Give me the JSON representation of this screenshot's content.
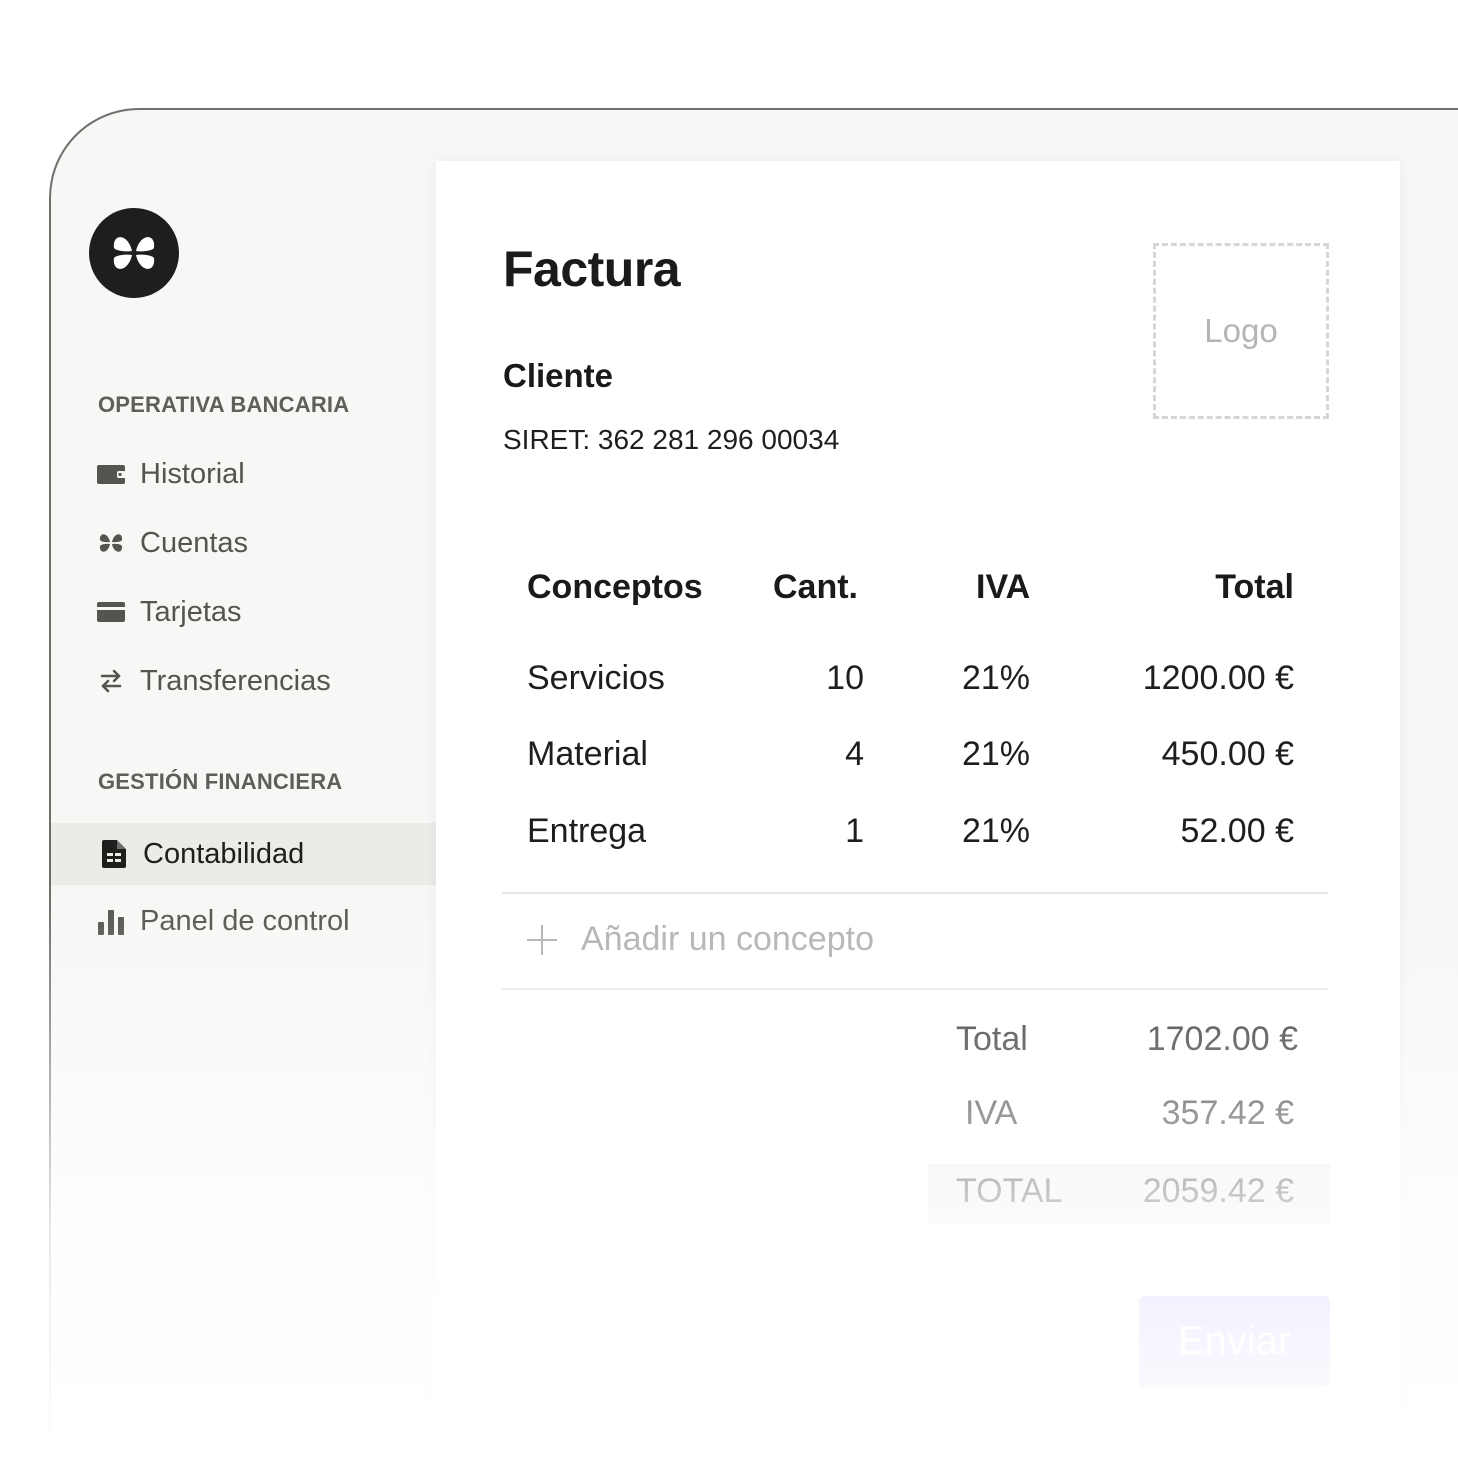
{
  "sidebar": {
    "sections": [
      {
        "title": "OPERATIVA BANCARIA"
      },
      {
        "title": "GESTIÓN FINANCIERA"
      }
    ],
    "items": [
      {
        "label": "Historial",
        "icon": "wallet-icon"
      },
      {
        "label": "Cuentas",
        "icon": "accounts-icon"
      },
      {
        "label": "Tarjetas",
        "icon": "card-icon"
      },
      {
        "label": "Transferencias",
        "icon": "transfer-arrows-icon"
      },
      {
        "label": "Contabilidad",
        "icon": "document-icon",
        "active": true
      },
      {
        "label": "Panel de control",
        "icon": "bar-chart-icon"
      }
    ]
  },
  "invoice": {
    "title": "Factura",
    "client_label": "Cliente",
    "siret": "SIRET: 362 281 296 00034",
    "logo_placeholder": "Logo",
    "columns": [
      "Conceptos",
      "Cant.",
      "IVA",
      "Total"
    ],
    "rows": [
      {
        "concept": "Servicios",
        "qty": "10",
        "vat": "21%",
        "total": "1200.00 €"
      },
      {
        "concept": "Material",
        "qty": "4",
        "vat": "21%",
        "total": "450.00 €"
      },
      {
        "concept": "Entrega",
        "qty": "1",
        "vat": "21%",
        "total": "52.00 €"
      }
    ],
    "add_concept": "Añadir un concepto",
    "summary": {
      "subtotal_label": "Total",
      "subtotal_value": "1702.00 €",
      "vat_label": "IVA",
      "vat_value": "357.42 €",
      "grand_label": "TOTAL",
      "grand_value": "2059.42 €"
    },
    "send_label": "Enviar"
  },
  "colors": {
    "accent": "#9b7ef2",
    "dark": "#1e1e1c",
    "highlight": "#ebebe8"
  }
}
